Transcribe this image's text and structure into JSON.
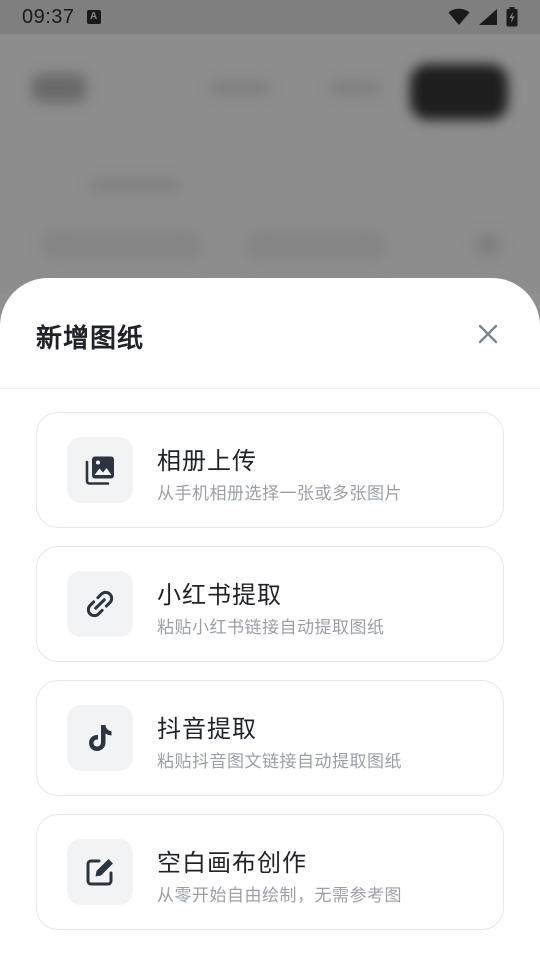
{
  "status_bar": {
    "time": "09:37",
    "notification_icon": "a-icon",
    "icons": [
      "wifi-icon",
      "signal-icon",
      "battery-charging-icon"
    ]
  },
  "sheet": {
    "title": "新增图纸",
    "close_icon": "close-icon",
    "options": [
      {
        "title": "相册上传",
        "subtitle": "从手机相册选择一张或多张图片",
        "icon": "photo-library-icon"
      },
      {
        "title": "小红书提取",
        "subtitle": "粘贴小红书链接自动提取图纸",
        "icon": "link-icon"
      },
      {
        "title": "抖音提取",
        "subtitle": "粘贴抖音图文链接自动提取图纸",
        "icon": "tiktok-icon"
      },
      {
        "title": "空白画布创作",
        "subtitle": "从零开始自由绘制，无需参考图",
        "icon": "edit-square-icon"
      }
    ]
  },
  "colors": {
    "title": "#1f2329",
    "subtitle": "#9aa0a8",
    "icon": "#2b3440",
    "icon_bg": "#f2f3f5",
    "card_border": "#e4e7eb",
    "scrim": "#8f8f8f"
  }
}
